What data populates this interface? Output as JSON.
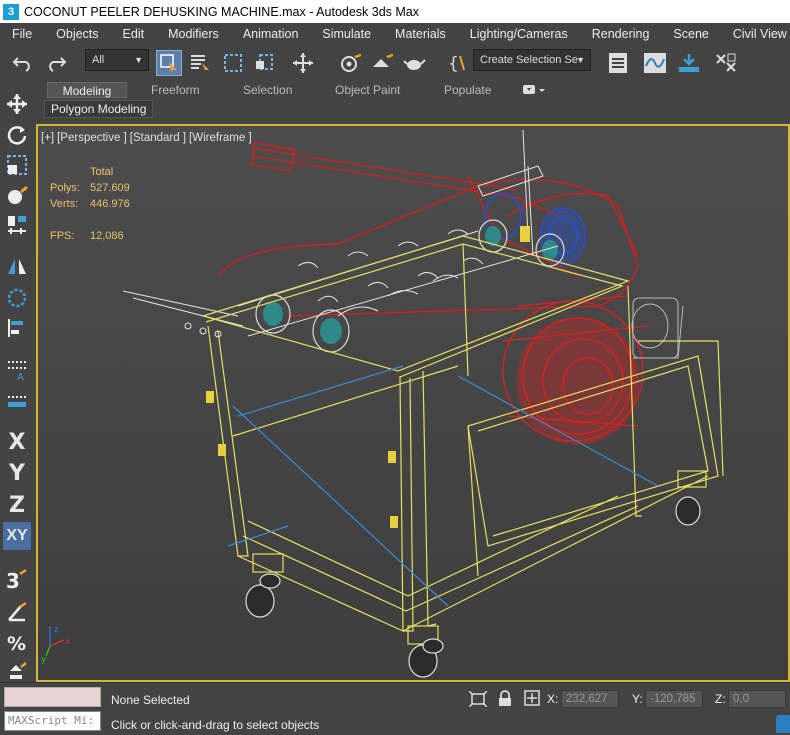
{
  "window": {
    "title": "COCONUT PEELER DEHUSKING MACHINE.max - Autodesk 3ds Max",
    "app_icon": "3"
  },
  "menu": [
    "File",
    "Objects",
    "Edit",
    "Modifiers",
    "Animation",
    "Simulate",
    "Materials",
    "Lighting/Cameras",
    "Rendering",
    "Scene",
    "Civil View"
  ],
  "toolbar": {
    "filter_value": "All",
    "selection_set_placeholder": "Create Selection Se"
  },
  "ribbon": {
    "tabs": [
      "Modeling",
      "Freeform",
      "Selection",
      "Object Paint",
      "Populate"
    ],
    "active_tab": "Modeling",
    "panel_tab": "Polygon Modeling"
  },
  "left_tools": {
    "x": "X",
    "y": "Y",
    "z": "Z",
    "xy": "XY"
  },
  "viewport": {
    "labels": [
      "[+]",
      "[Perspective ]",
      "[Standard ]",
      "[Wireframe ]"
    ],
    "stats": {
      "header": "Total",
      "polys_label": "Polys:",
      "polys": "527.609",
      "verts_label": "Verts:",
      "verts": "446.976",
      "fps_label": "FPS:",
      "fps": "12,086"
    },
    "border_color": "#d9b43a",
    "axis": {
      "x": "x",
      "y": "y",
      "z": "z"
    }
  },
  "status": {
    "selection": "None Selected",
    "prompt": "Click or click-and-drag to select objects",
    "maxscript": "MAXScript Mi:",
    "x_label": "X:",
    "x": "232,627",
    "y_label": "Y:",
    "y": "-120,785",
    "z_label": "Z:",
    "z": "0,0"
  }
}
